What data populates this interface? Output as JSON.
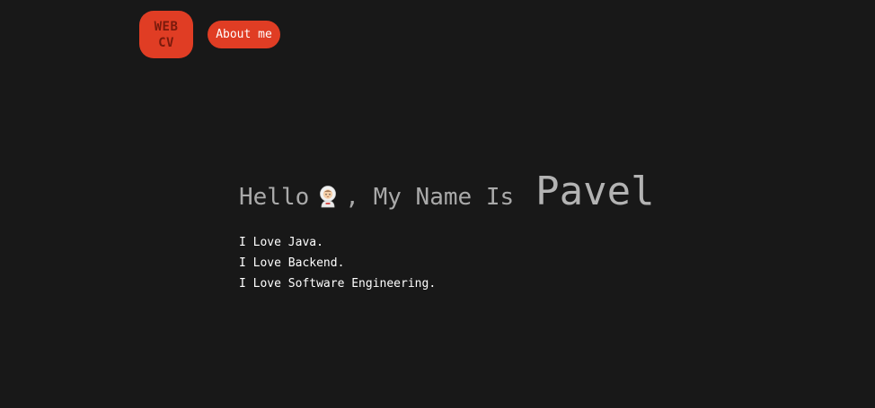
{
  "header": {
    "logo_line1": "WEB",
    "logo_line2": "CV",
    "nav_about": "About me"
  },
  "hero": {
    "greeting_before": "Hello",
    "emoji_icon": "astronaut-icon",
    "greeting_after": ", My Name Is",
    "name": "Pavel",
    "lines": [
      "I Love Java.",
      "I Love Backend.",
      "I Love Software Engineering."
    ]
  },
  "colors": {
    "background": "#181818",
    "accent": "#e03d24",
    "muted_text": "#a9a9a9",
    "text": "#ffffff"
  }
}
